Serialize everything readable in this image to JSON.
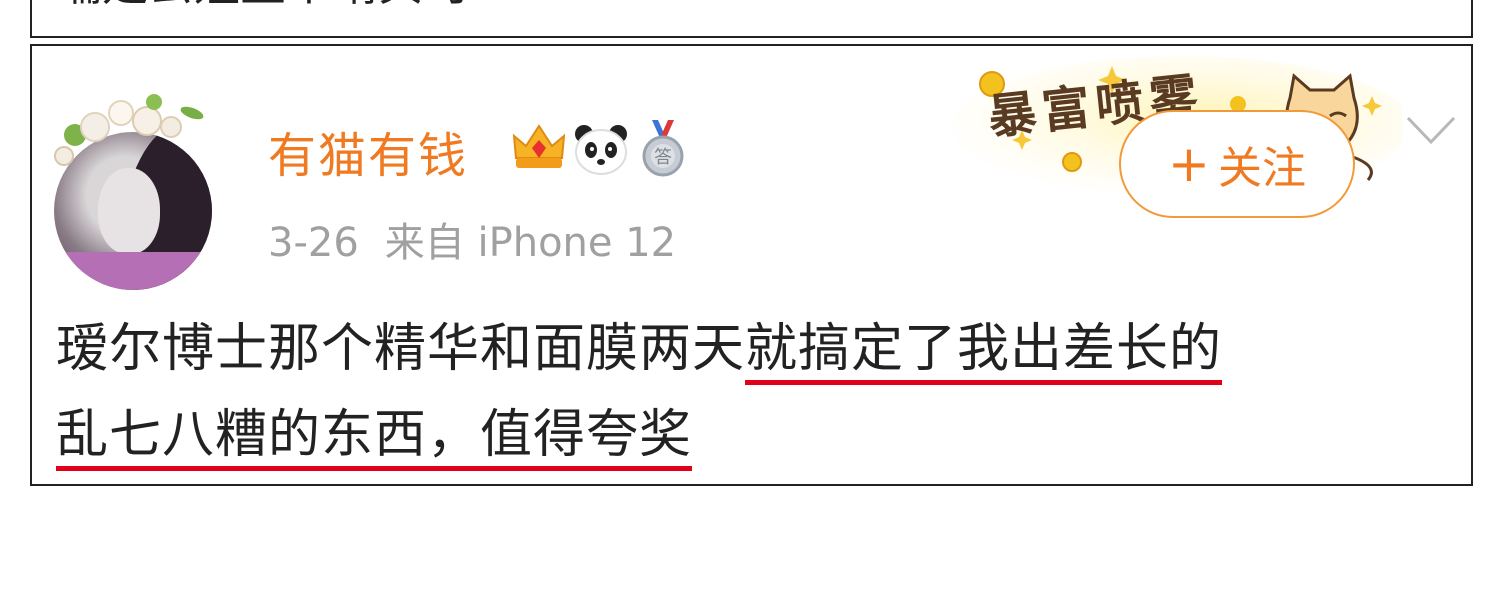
{
  "previous_post": {
    "text_fragment": "喘是去媪里个晴贝时"
  },
  "post": {
    "username": "有猫有钱",
    "date": "3-26",
    "source": "来自 iPhone 12",
    "follow_button": {
      "plus": "+",
      "label": "关注"
    },
    "banner_text": "暴富喷雾",
    "content": {
      "plain_part": "瑷尔博士那个精华和面膜两天",
      "underlined_line1": "就搞定了我出差长的",
      "underlined_line2": "乱七八糟的东西，值得夸奖"
    },
    "badges": [
      "crown-icon",
      "panda-icon",
      "medal-icon"
    ]
  },
  "colors": {
    "username": "#f07a22",
    "follow_border": "#f29a3a",
    "meta_text": "#a0a0a0",
    "underline": "#e0001a",
    "body_text": "#222222"
  }
}
